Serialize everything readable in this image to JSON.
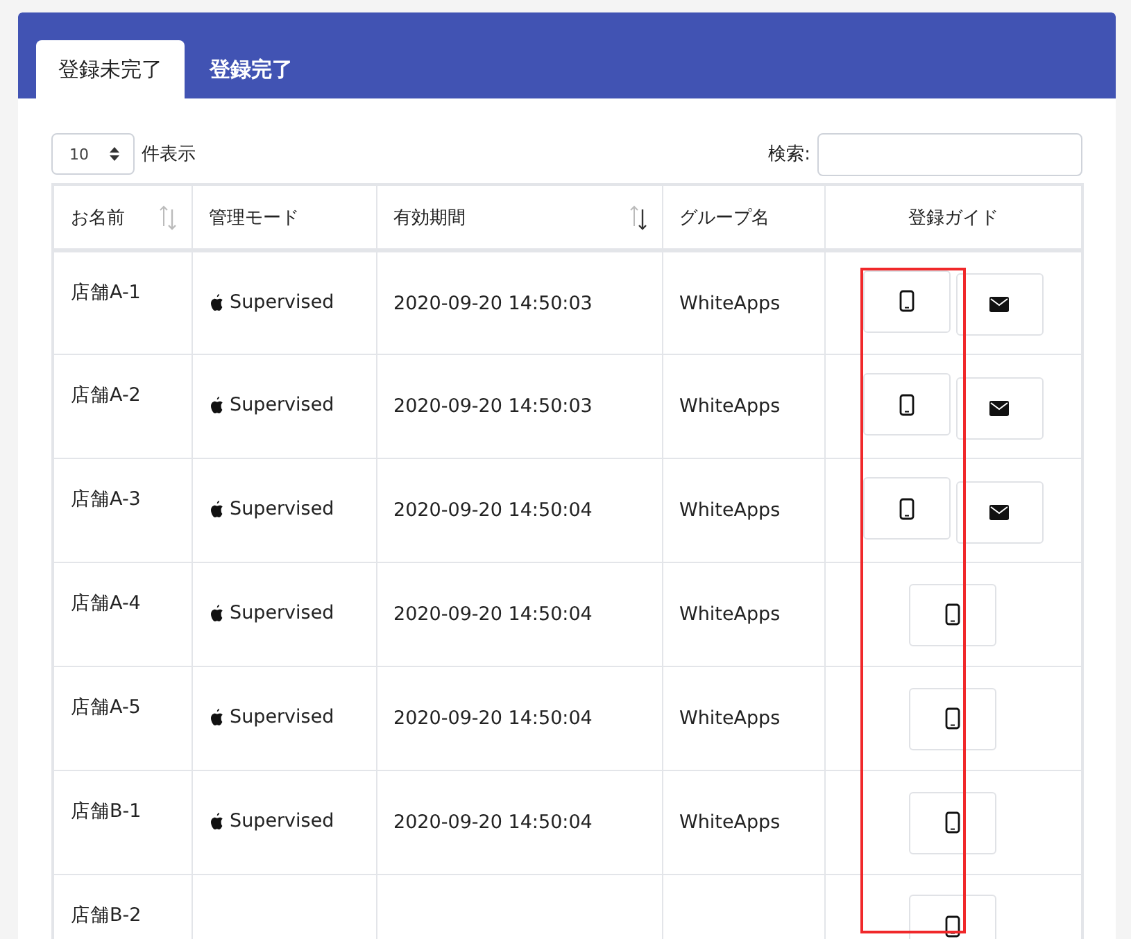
{
  "tabs": [
    {
      "label": "登録未完了",
      "selected": true
    },
    {
      "label": "登録完了",
      "selected": false
    }
  ],
  "length_control": {
    "value": "10",
    "label": "件表示"
  },
  "search": {
    "label": "検索:"
  },
  "table": {
    "columns": [
      {
        "label": "お名前",
        "sortable": true,
        "sorted": false
      },
      {
        "label": "管理モード"
      },
      {
        "label": "有効期間",
        "sortable": true,
        "sorted": true
      },
      {
        "label": "グループ名"
      },
      {
        "label": "登録ガイド",
        "centered": true
      }
    ],
    "rows": [
      {
        "name": "店舗A-1",
        "mode": "Supervised",
        "expires": "2020-09-20 14:50:03",
        "group": "WhiteApps",
        "guides": [
          {
            "kind": "device"
          },
          {
            "kind": "mail"
          }
        ]
      },
      {
        "name": "店舗A-2",
        "mode": "Supervised",
        "expires": "2020-09-20 14:50:03",
        "group": "WhiteApps",
        "guides": [
          {
            "kind": "device"
          },
          {
            "kind": "mail"
          }
        ]
      },
      {
        "name": "店舗A-3",
        "mode": "Supervised",
        "expires": "2020-09-20 14:50:04",
        "group": "WhiteApps",
        "guides": [
          {
            "kind": "device"
          },
          {
            "kind": "mail"
          }
        ]
      },
      {
        "name": "店舗A-4",
        "mode": "Supervised",
        "expires": "2020-09-20 14:50:04",
        "group": "WhiteApps",
        "guides": [
          {
            "kind": "device"
          }
        ]
      },
      {
        "name": "店舗A-5",
        "mode": "Supervised",
        "expires": "2020-09-20 14:50:04",
        "group": "WhiteApps",
        "guides": [
          {
            "kind": "device"
          }
        ]
      },
      {
        "name": "店舗B-1",
        "mode": "Supervised",
        "expires": "2020-09-20 14:50:04",
        "group": "WhiteApps",
        "guides": [
          {
            "kind": "device"
          }
        ]
      },
      {
        "name": "店舗B-2",
        "guides": [
          {
            "kind": "device"
          }
        ]
      }
    ]
  }
}
